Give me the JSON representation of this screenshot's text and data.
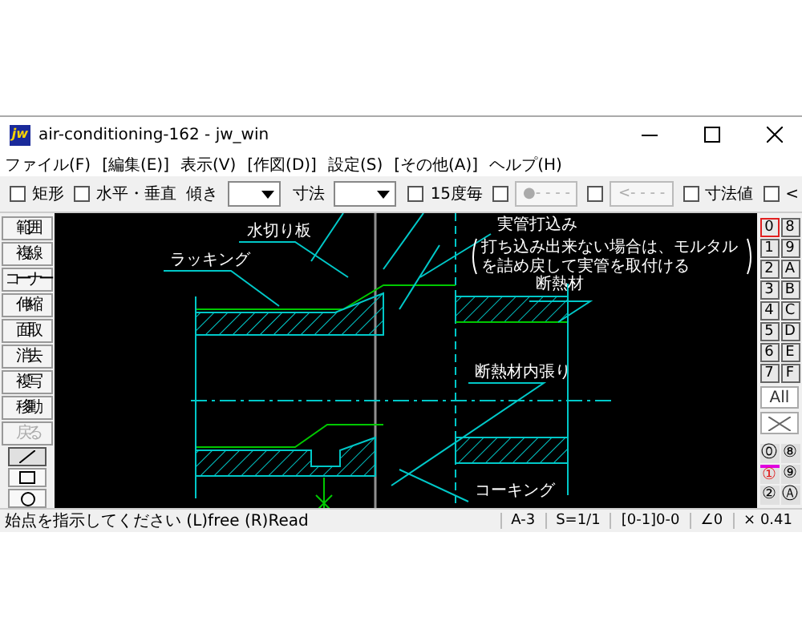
{
  "window": {
    "title": "air-conditioning-162 - jw_win",
    "icon_text": "jw"
  },
  "menu": [
    {
      "label": "ファイル(F)"
    },
    {
      "label": "[編集(E)]"
    },
    {
      "label": "表示(V)"
    },
    {
      "label": "[作図(D)]"
    },
    {
      "label": "設定(S)"
    },
    {
      "label": "[その他(A)]"
    },
    {
      "label": "ヘルプ(H)"
    }
  ],
  "toolbar": [
    {
      "kind": "checkbox",
      "label": "矩形",
      "checked": false
    },
    {
      "kind": "checkbox",
      "label": "水平・垂直",
      "checked": false
    },
    {
      "kind": "dropdown",
      "label": "傾き"
    },
    {
      "kind": "dropdown",
      "label": "寸法"
    },
    {
      "kind": "checkbox",
      "label": "15度毎",
      "checked": false
    },
    {
      "kind": "checkbutton",
      "label": "●- - - -",
      "checked": false,
      "disabled": true
    },
    {
      "kind": "checkbutton",
      "label": "<- - - -",
      "checked": false,
      "disabled": true
    },
    {
      "kind": "checkbox",
      "label": "寸法値",
      "checked": false
    },
    {
      "kind": "checkbox",
      "label": "<",
      "checked": false
    }
  ],
  "tools": [
    {
      "label": "範囲",
      "disabled": false
    },
    {
      "label": "複線",
      "disabled": false
    },
    {
      "label": "コーナー",
      "disabled": false
    },
    {
      "label": "伸縮",
      "disabled": false
    },
    {
      "label": "面取",
      "disabled": false
    },
    {
      "label": "消去",
      "disabled": false
    },
    {
      "label": "複写",
      "disabled": false
    },
    {
      "label": "移動",
      "disabled": false
    },
    {
      "label": "戻る",
      "disabled": true
    }
  ],
  "draw_tools": [
    {
      "kind": "line",
      "selected": true
    },
    {
      "kind": "rectangle",
      "selected": false
    },
    {
      "kind": "circle",
      "selected": false
    }
  ],
  "layers": [
    {
      "label": "0",
      "selected": true
    },
    {
      "label": "1",
      "selected": false
    },
    {
      "label": "2",
      "selected": false
    },
    {
      "label": "3",
      "selected": false
    },
    {
      "label": "4",
      "selected": false
    },
    {
      "label": "5",
      "selected": false
    },
    {
      "label": "6",
      "selected": false
    },
    {
      "label": "7",
      "selected": false
    },
    {
      "label": "8",
      "selected": false
    },
    {
      "label": "9",
      "selected": false
    },
    {
      "label": "A",
      "selected": false
    },
    {
      "label": "B",
      "selected": false
    },
    {
      "label": "C",
      "selected": false
    },
    {
      "label": "D",
      "selected": false
    },
    {
      "label": "E",
      "selected": false
    },
    {
      "label": "F",
      "selected": false
    }
  ],
  "layer_all": "All",
  "groups": [
    {
      "label": "⓪",
      "selected": false
    },
    {
      "label": "①",
      "selected": true
    },
    {
      "label": "②",
      "selected": false
    },
    {
      "label": "⑧",
      "selected": false
    },
    {
      "label": "⑨",
      "selected": false
    },
    {
      "label": "Ⓐ",
      "selected": false
    }
  ],
  "drawing": {
    "labels": [
      {
        "text": "水切り板"
      },
      {
        "text": "ラッキング"
      },
      {
        "text": "実管打込み"
      },
      {
        "text": "打ち込み出来ない場合は、モルタル"
      },
      {
        "text": "を詰め戻して実管を取付ける"
      },
      {
        "text": "断熱材"
      },
      {
        "text": "断熱材内張り"
      },
      {
        "text": "コーキング"
      }
    ]
  },
  "status": {
    "message": "始点を指示してください (L)free (R)Read",
    "fields": [
      "A-3",
      "S=1/1",
      "[0-1]0-0",
      "∠0",
      "× 0.41"
    ]
  }
}
